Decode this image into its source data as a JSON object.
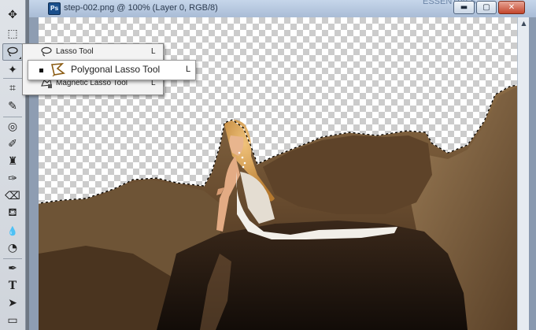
{
  "document": {
    "title": "step-002.png @ 100% (Layer 0, RGB/8)",
    "app_icon_text": "Ps",
    "top_strip_text": "ESSENTIALS",
    "window_buttons": {
      "minimize": "▬",
      "maximize": "▢",
      "close": "✕"
    }
  },
  "tools": [
    {
      "name": "move-tool",
      "icon": "move-icon",
      "glyph": "✥"
    },
    {
      "name": "marquee-tool",
      "icon": "marquee-icon",
      "glyph": "⬚"
    },
    {
      "name": "lasso-tool",
      "icon": "lasso-icon",
      "glyph": "",
      "active": true
    },
    {
      "name": "quick-selection-tool",
      "icon": "quick-selection-icon",
      "glyph": "✦"
    },
    {
      "name": "crop-tool",
      "icon": "crop-icon",
      "glyph": "⌗"
    },
    {
      "name": "eyedropper-tool",
      "icon": "eyedropper-icon",
      "glyph": "✎"
    },
    {
      "name": "healing-brush-tool",
      "icon": "healing-icon",
      "glyph": "◎"
    },
    {
      "name": "brush-tool",
      "icon": "brush-icon",
      "glyph": "✐"
    },
    {
      "name": "clone-stamp-tool",
      "icon": "stamp-icon",
      "glyph": "♜"
    },
    {
      "name": "history-brush-tool",
      "icon": "history-brush-icon",
      "glyph": "✑"
    },
    {
      "name": "eraser-tool",
      "icon": "eraser-icon",
      "glyph": "⌫"
    },
    {
      "name": "paint-bucket-tool",
      "icon": "bucket-icon",
      "glyph": "⛾"
    },
    {
      "name": "blur-tool",
      "icon": "blur-icon",
      "glyph": "💧"
    },
    {
      "name": "dodge-tool",
      "icon": "dodge-icon",
      "glyph": "◔"
    },
    {
      "name": "pen-tool",
      "icon": "pen-icon",
      "glyph": "✒"
    },
    {
      "name": "type-tool",
      "icon": "type-icon",
      "glyph": "T"
    },
    {
      "name": "path-selection-tool",
      "icon": "path-select-icon",
      "glyph": "➤"
    },
    {
      "name": "shape-tool",
      "icon": "shape-icon",
      "glyph": "▭"
    }
  ],
  "flyout": {
    "items": [
      {
        "label": "Lasso Tool",
        "shortcut": "L",
        "icon": "lasso-icon"
      },
      {
        "label": "Polygonal Lasso Tool",
        "shortcut": "L",
        "icon": "polygonal-lasso-icon",
        "selected": true
      },
      {
        "label": "Magnetic Lasso Tool",
        "shortcut": "L",
        "icon": "magnetic-lasso-icon"
      }
    ]
  },
  "colors": {
    "selection_border": "#ffffff",
    "rock": "#6b5134",
    "water": "#1c140e",
    "accent": "#1b4f8c"
  }
}
